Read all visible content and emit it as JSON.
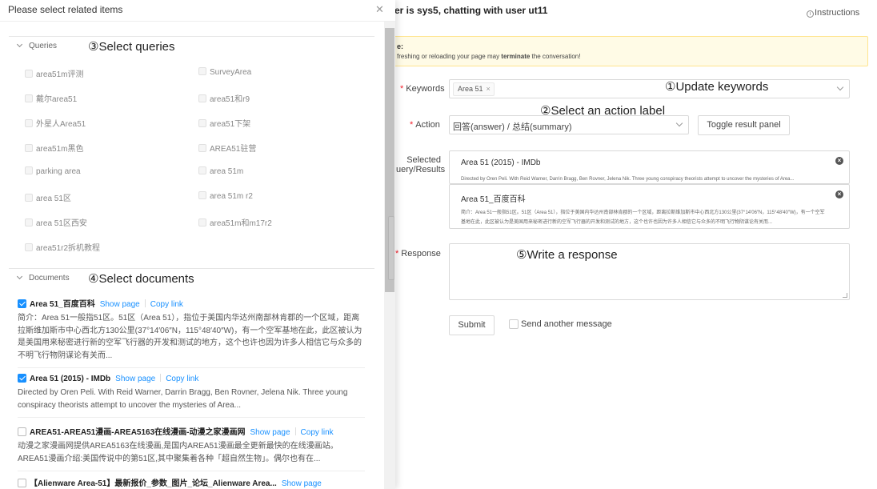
{
  "header": {
    "title": "er is sys5, chatting with user ut11",
    "instructions_label": "Instructions"
  },
  "warning": {
    "line1": "e:",
    "line2_pre": "freshing or reloading your page may ",
    "line2_bold": "terminate",
    "line2_post": " the conversation!"
  },
  "form": {
    "keywords_label": "Keywords",
    "keywords_tag": "Area 51",
    "action_label": "Action",
    "action_value": "回答(answer) / 总结(summary)",
    "toggle_button": "Toggle result panel",
    "selected_label_line1": "Selected",
    "selected_label_line2": "uery/Results",
    "selected": [
      {
        "title": "Area 51 (2015) - IMDb",
        "snippet": "Directed by Oren Peli. With Reid Warner, Darrin Bragg, Ben Rovner, Jelena Nik. Three young conspiracy theorists attempt to uncover the mysteries of Area..."
      },
      {
        "title": "Area 51_百度百科",
        "snippet": "简介：Area 51一般指51区。51区（Area 51），指位于美国内华达州南部林肯郡的一个区域，距离拉斯维加斯市中心西北方130公里(37°14′06″N，115°48′40″W)，有一个空军基地在此，此区被认为是美国用来秘密进行新的空军飞行器的开发和测试的地方，这个也许也因为许多人相信它与众多的不明飞行物阴谋论有关而..."
      }
    ],
    "response_label": "Response",
    "submit_button": "Submit",
    "send_another_label": "Send another message"
  },
  "annotations": {
    "update_keywords": "①Update keywords",
    "select_action": "②Select an action label",
    "select_queries": "③Select queries",
    "select_documents": "④Select documents",
    "write_response": "⑤Write a response"
  },
  "drawer": {
    "title": "Please select related items",
    "queries_header": "Queries",
    "queries_left": [
      "area51m评测",
      "戴尔area51",
      "外星人Area51",
      "area51m黑色",
      "parking area",
      "area 51区",
      "area 51区西安",
      "area51r2拆机教程"
    ],
    "queries_right": [
      "SurveyArea",
      "area51和r9",
      "area51下架",
      "AREA51驻营",
      "area 51m",
      "area 51m r2",
      "area51m和m17r2"
    ],
    "documents_header": "Documents",
    "show_page": "Show page",
    "copy_link": "Copy link",
    "documents": [
      {
        "title": "Area 51_百度百科",
        "checked": true,
        "snippet": "简介：Area 51一般指51区。51区（Area 51），指位于美国内华达州南部林肯郡的一个区域，距离拉斯维加斯市中心西北方130公里(37°14′06″N，115°48′40″W)，有一个空军基地在此，此区被认为是美国用来秘密进行新的空军飞行器的开发和测试的地方，这个也许也因为许多人相信它与众多的不明飞行物阴谋论有关而..."
      },
      {
        "title": "Area 51 (2015) - IMDb",
        "checked": true,
        "snippet": "Directed by Oren Peli. With Reid Warner, Darrin Bragg, Ben Rovner, Jelena Nik. Three young conspiracy theorists attempt to uncover the mysteries of Area..."
      },
      {
        "title": "AREA51-AREA51漫画-AREA5163在线漫画-动漫之家漫画网",
        "checked": false,
        "snippet": "动漫之家漫画网提供AREA5163在线漫画,是国内AREA51漫画最全更新最快的在线漫画站。AREA51漫画介绍:美国传说中的第51区,其中聚集着各种「超自然生物」。偶尔也有在..."
      },
      {
        "title": "【Alienware Area-51】最新报价_参数_图片_论坛_Alienware Area...",
        "checked": false,
        "snippet": ""
      }
    ]
  },
  "colors": {
    "accent": "#1890ff",
    "required": "#f5222d",
    "warning_bg": "#fffbe6",
    "warning_border": "#ffe58f"
  }
}
